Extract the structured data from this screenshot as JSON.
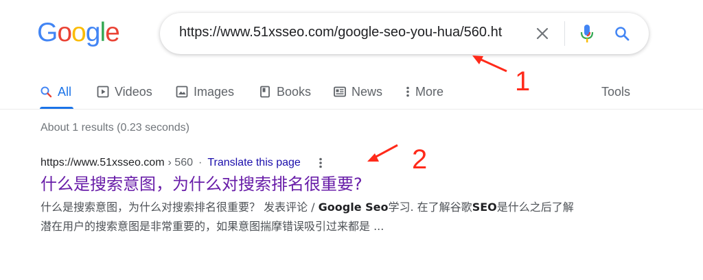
{
  "logo": {
    "letters": [
      "G",
      "o",
      "o",
      "g",
      "l",
      "e"
    ],
    "colors": [
      "#4285F4",
      "#EA4335",
      "#FBBC05",
      "#4285F4",
      "#34A853",
      "#EA4335"
    ]
  },
  "search": {
    "query": "https://www.51xsseo.com/google-seo-you-hua/560.ht"
  },
  "tabs": [
    {
      "label": "All",
      "icon": "search-icon",
      "active": true
    },
    {
      "label": "Videos",
      "icon": "play-icon"
    },
    {
      "label": "Images",
      "icon": "image-icon"
    },
    {
      "label": "Books",
      "icon": "book-icon"
    },
    {
      "label": "News",
      "icon": "news-icon"
    },
    {
      "label": "More",
      "icon": "more-vert-icon"
    },
    {
      "label": "Tools"
    }
  ],
  "stats": "About 1 results (0.23 seconds)",
  "result": {
    "url": "https://www.51xsseo.com",
    "breadcrumb": "› 560",
    "separator": "·",
    "translate": "Translate this page",
    "title": "什么是搜索意图，为什么对搜索排名很重要?",
    "snippet_1": "什么是搜索意图，为什么对搜索排名很重要？ 发表评论 / ",
    "snippet_bold_1": "Google Seo",
    "snippet_2": "学习. 在了解谷歌",
    "snippet_bold_2": "SEO",
    "snippet_3": "是什么之后了解潜在用户的搜索意图是非常重要的，如果意图揣摩错误吸引过来都是 ..."
  },
  "annotations": {
    "label_1": "1",
    "label_2": "2",
    "color": "#ff2a1a"
  }
}
